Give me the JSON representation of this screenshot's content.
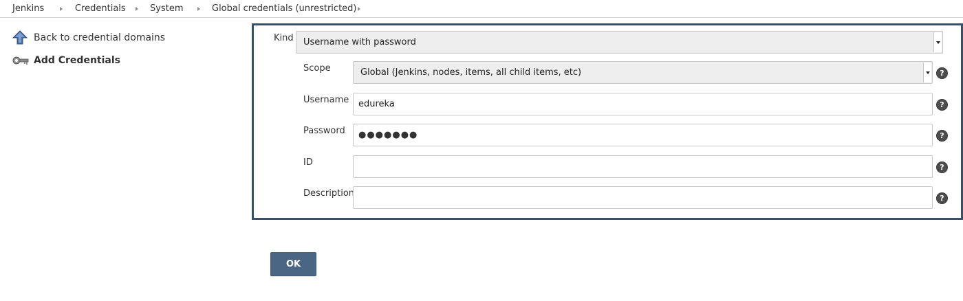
{
  "breadcrumb": {
    "items": [
      "Jenkins",
      "Credentials",
      "System",
      "Global credentials (unrestricted)"
    ]
  },
  "side_panel": {
    "back_label": "Back to credential domains",
    "back_icon": "up-arrow-icon",
    "add_label": "Add Credentials",
    "add_icon": "key-icon"
  },
  "form": {
    "kind_label": "Kind",
    "kind_value": "Username with password",
    "scope_label": "Scope",
    "scope_value": "Global (Jenkins, nodes, items, all child items, etc)",
    "username_label": "Username",
    "username_value": "edureka",
    "password_label": "Password",
    "password_value": "●●●●●●●",
    "id_label": "ID",
    "id_value": "",
    "description_label": "Description",
    "description_value": "",
    "help_glyph": "?"
  },
  "actions": {
    "ok_label": "OK"
  },
  "colors": {
    "form_border": "#39506b",
    "ok_button": "#4b6585",
    "select_bg": "#eeeeee"
  }
}
